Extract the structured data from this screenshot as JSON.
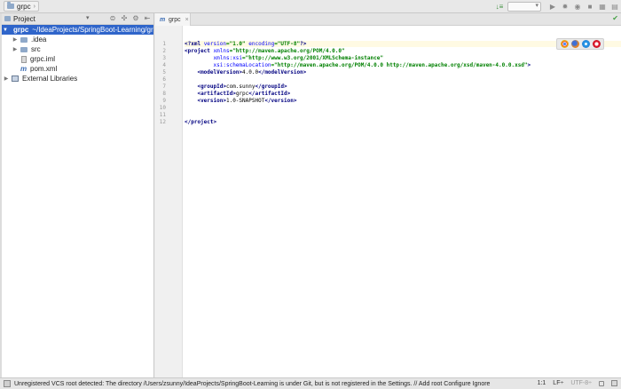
{
  "navbar": {
    "breadcrumb": "grpc"
  },
  "project_panel": {
    "title": "Project",
    "tree": [
      {
        "label": "grpc",
        "path": "~/IdeaProjects/SpringBoot-Learning/grpc",
        "expanded": true
      },
      {
        "label": ".idea"
      },
      {
        "label": "src"
      },
      {
        "label": "grpc.iml"
      },
      {
        "label": "pom.xml"
      },
      {
        "label": "External Libraries"
      }
    ]
  },
  "editor": {
    "tab_label": "grpc",
    "line_numbers": [
      "1",
      "2",
      "3",
      "4",
      "5",
      "6",
      "7",
      "8",
      "9",
      "10",
      "11",
      "12"
    ],
    "lines": {
      "l1_a": "<?xml ",
      "l1_b": "version",
      "l1_c": "=\"1.0\" ",
      "l1_d": "encoding",
      "l1_e": "=\"UTF-8\"",
      "l1_f": "?>",
      "l2_a": "<project ",
      "l2_b": "xmlns",
      "l2_c": "=\"http://maven.apache.org/POM/4.0.0\"",
      "l3_pre": "         ",
      "l3_b": "xmlns:xsi",
      "l3_c": "=\"http://www.w3.org/2001/XMLSchema-instance\"",
      "l4_pre": "         ",
      "l4_b": "xsi:schemaLocation",
      "l4_c": "=\"http://maven.apache.org/POM/4.0.0 http://maven.apache.org/xsd/maven-4.0.0.xsd\"",
      "l4_d": ">",
      "l5_pre": "    ",
      "l5_a": "<modelVersion>",
      "l5_b": "4.0.0",
      "l5_c": "</modelVersion>",
      "l7_pre": "    ",
      "l7_a": "<groupId>",
      "l7_b": "com.sunny",
      "l7_c": "</groupId>",
      "l8_pre": "    ",
      "l8_a": "<artifactId>",
      "l8_b": "grpc",
      "l8_c": "</artifactId>",
      "l9_pre": "    ",
      "l9_a": "<version>",
      "l9_b": "1.0-SNAPSHOT",
      "l9_c": "</version>",
      "l12_a": "</project>"
    }
  },
  "statusbar": {
    "message": "Unregistered VCS root detected: The directory /Users/zsunny/IdeaProjects/SpringBoot-Learning is under Git, but is not registered in the Settings. // Add root  Configure  Ignore",
    "position": "1:1",
    "line_sep": "LF÷",
    "encoding": "UTF-8÷"
  },
  "icons": {
    "browsers": [
      "chrome-icon",
      "firefox-icon",
      "safari-icon",
      "opera-icon"
    ]
  }
}
